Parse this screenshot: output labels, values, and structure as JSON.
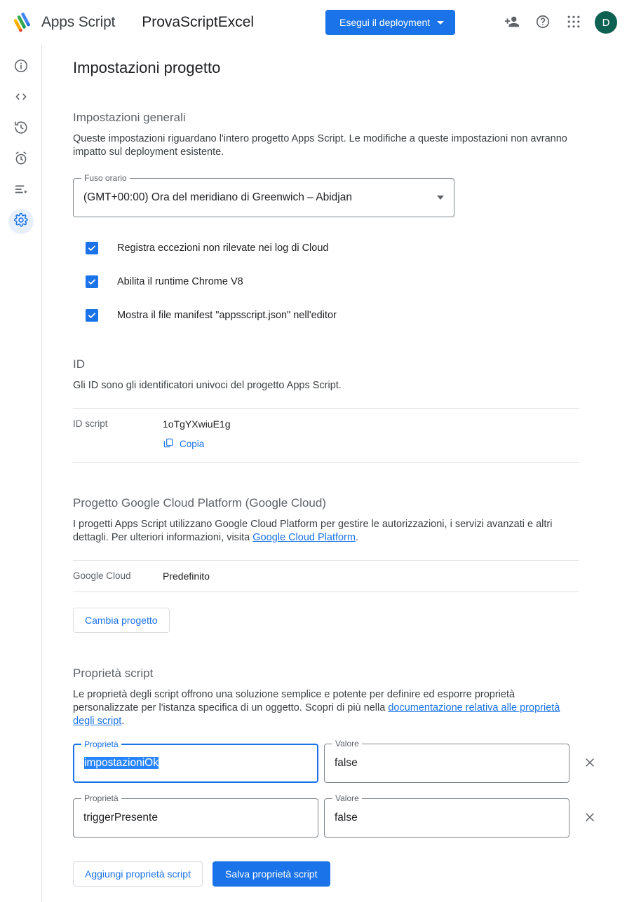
{
  "header": {
    "logo_text": "Apps Script",
    "logo_icon": "apps-script-logo",
    "project_title": "ProvaScriptExcel",
    "deploy_label": "Esegui il deployment",
    "deploy_caret_icon": "chevron-down-icon",
    "add_person_icon": "person-add-icon",
    "help_icon": "help-circle-icon",
    "apps_grid_icon": "apps-grid-icon",
    "avatar_initial": "D",
    "accent_color": "#1a73e8",
    "avatar_color": "#0f6152"
  },
  "sidebar": {
    "items": [
      {
        "name": "overview",
        "icon": "info-circle-icon",
        "active": false
      },
      {
        "name": "editor",
        "icon": "code-brackets-icon",
        "active": false
      },
      {
        "name": "history",
        "icon": "history-clock-icon",
        "active": false
      },
      {
        "name": "triggers",
        "icon": "alarm-clock-icon",
        "active": false
      },
      {
        "name": "executions",
        "icon": "executions-list-icon",
        "active": false
      },
      {
        "name": "settings",
        "icon": "gear-icon",
        "active": true
      }
    ]
  },
  "page": {
    "title": "Impostazioni progetto"
  },
  "general": {
    "heading": "Impostazioni generali",
    "description": "Queste impostazioni riguardano l'intero progetto Apps Script. Le modifiche a queste impostazioni non avranno impatto sul deployment esistente.",
    "timezone": {
      "label": "Fuso orario",
      "value": "(GMT+00:00) Ora del meridiano di Greenwich – Abidjan",
      "caret_icon": "chevron-down-icon"
    },
    "checkboxes": [
      {
        "label": "Registra eccezioni non rilevate nei log di Cloud",
        "checked": true
      },
      {
        "label": "Abilita il runtime Chrome V8",
        "checked": true
      },
      {
        "label": "Mostra il file manifest \"appsscript.json\" nell'editor",
        "checked": true
      }
    ]
  },
  "ids": {
    "heading": "ID",
    "description": "Gli ID sono gli identificatori univoci del progetto Apps Script.",
    "script_id_key": "ID script",
    "script_id_value": "1oTgYXwiuE1g",
    "copy_label": "Copia",
    "copy_icon": "copy-icon"
  },
  "gcp": {
    "heading": "Progetto Google Cloud Platform (Google Cloud)",
    "description_part1": "I progetti Apps Script utilizzano Google Cloud Platform per gestire le autorizzazioni, i servizi avanzati e altri dettagli. Per ulteriori informazioni, visita ",
    "link_text": "Google Cloud Platform",
    "description_part2": ".",
    "row_key": "Google Cloud",
    "row_value": "Predefinito",
    "change_button": "Cambia progetto"
  },
  "script_properties": {
    "heading": "Proprietà script",
    "description_part1": "Le proprietà degli script offrono una soluzione semplice e potente per definire ed esporre proprietà personalizzate per l'istanza specifica di un oggetto. Scopri di più nella ",
    "link_text": "documentazione relativa alle proprietà degli script",
    "description_part2": ".",
    "key_label": "Proprietà",
    "value_label": "Valore",
    "delete_icon": "close-x-icon",
    "rows": [
      {
        "key": "impostazioniOk",
        "value": "false",
        "focused": true,
        "selected": true
      },
      {
        "key": "triggerPresente",
        "value": "false",
        "focused": false,
        "selected": false
      }
    ],
    "add_button": "Aggiungi proprietà script",
    "save_button": "Salva proprietà script"
  }
}
